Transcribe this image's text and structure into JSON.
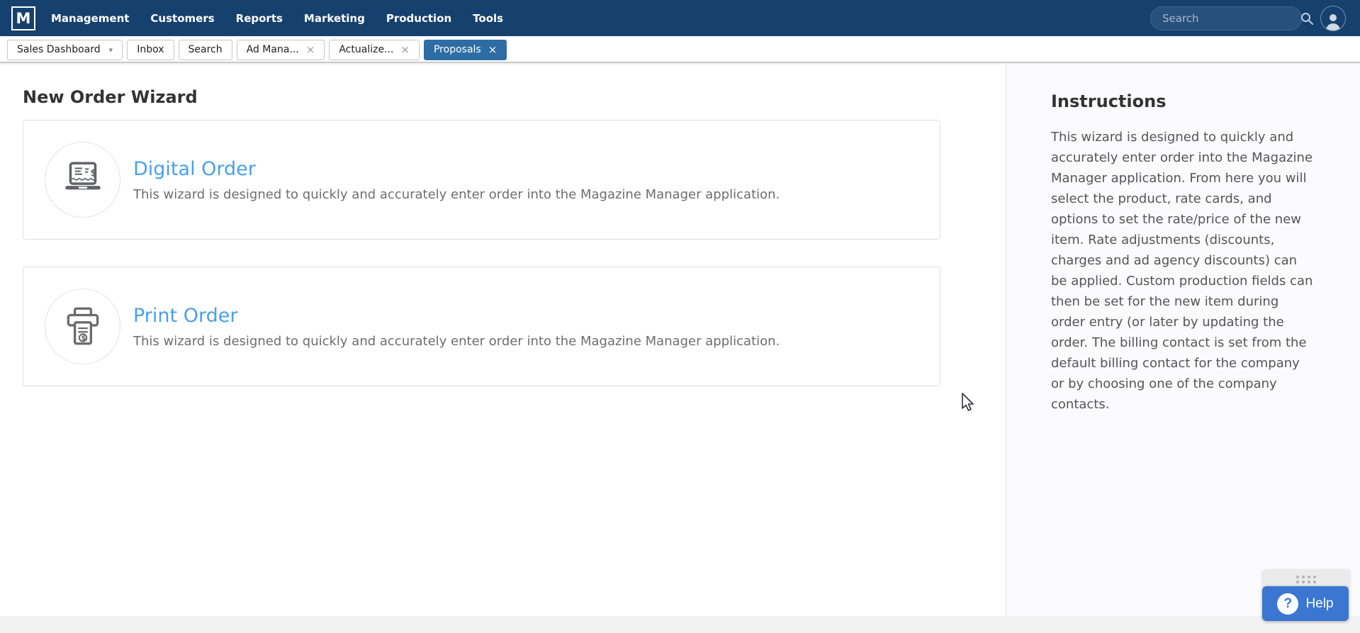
{
  "navbar": {
    "logo": "M",
    "items": [
      {
        "label": "Management"
      },
      {
        "label": "Customers"
      },
      {
        "label": "Reports"
      },
      {
        "label": "Marketing"
      },
      {
        "label": "Production"
      },
      {
        "label": "Tools"
      }
    ],
    "search": {
      "placeholder": "Search",
      "value": ""
    }
  },
  "tabs": {
    "items": [
      {
        "label": "Sales Dashboard",
        "type": "dropdown",
        "active": false
      },
      {
        "label": "Inbox",
        "type": "plain",
        "active": false
      },
      {
        "label": "Search",
        "type": "plain",
        "active": false
      },
      {
        "label": "Ad Mana...",
        "type": "closable",
        "active": false
      },
      {
        "label": "Actualize...",
        "type": "closable",
        "active": false
      },
      {
        "label": "Proposals",
        "type": "closable",
        "active": true
      }
    ]
  },
  "main": {
    "title": "New Order Wizard",
    "cards": [
      {
        "title": "Digital Order",
        "description": "This wizard is designed to quickly and accurately enter order into the Magazine Manager application.",
        "icon": "laptop-invoice-icon"
      },
      {
        "title": "Print Order",
        "description": "This wizard is designed to quickly and accurately enter order into the Magazine Manager application.",
        "icon": "printer-invoice-icon"
      }
    ]
  },
  "sidebar": {
    "title": "Instructions",
    "body": "This wizard is designed to quickly and accurately enter order into the Magazine Manager application. From here you will select the product, rate cards, and options to set the rate/price of the new item. Rate adjustments (discounts, charges and ad agency discounts) can be applied. Custom production fields can then be set for the new item during order entry (or later by updating the order. The billing contact is set from the default billing contact for the company or by choosing one of the company contacts."
  },
  "help": {
    "label": "Help"
  },
  "icons": {
    "close": "×",
    "caret_down": "▾",
    "question": "?"
  },
  "colors": {
    "navbar_bg": "#16406e",
    "active_tab": "#2e6da4",
    "link_blue": "#4aa0e8",
    "help_blue": "#3b76d2"
  }
}
